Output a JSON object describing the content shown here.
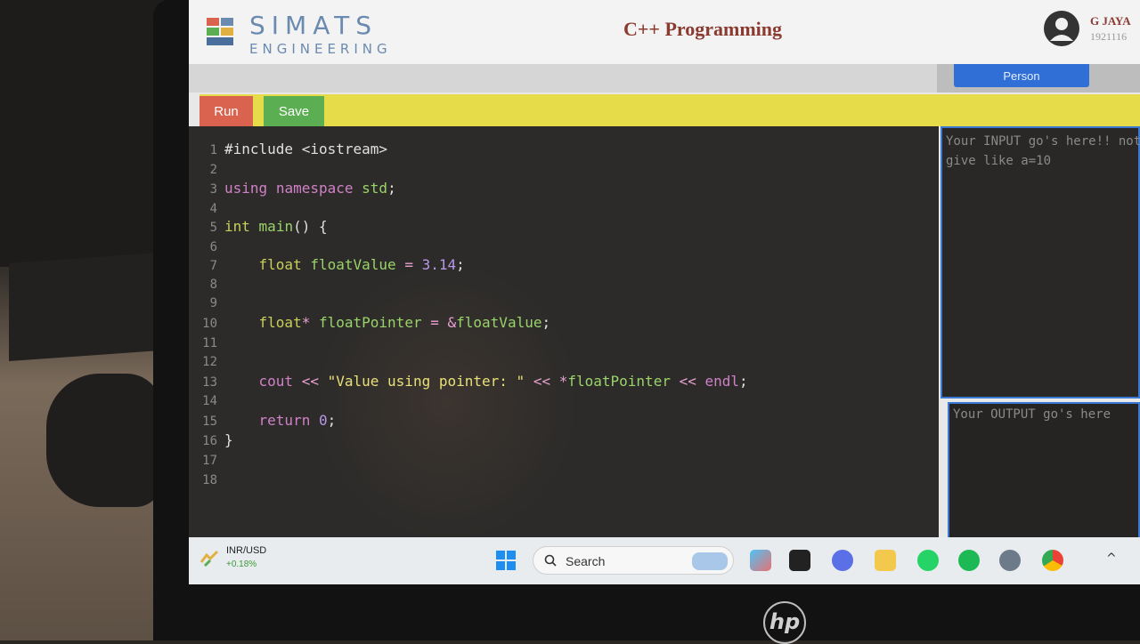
{
  "header": {
    "logo_name": "SIMATS",
    "logo_sub": "ENGINEERING",
    "title": "C++ Programming",
    "user_name": "G JAYA",
    "user_id": "1921116"
  },
  "subbar": {
    "person_label": "Person"
  },
  "toolbar": {
    "run_label": "Run",
    "save_label": "Save"
  },
  "editor": {
    "lines": [
      {
        "n": "1",
        "text": "#include <iostream>"
      },
      {
        "n": "2",
        "text": ""
      },
      {
        "n": "3",
        "text": "using namespace std;"
      },
      {
        "n": "4",
        "text": ""
      },
      {
        "n": "5",
        "text": "int main() {"
      },
      {
        "n": "6",
        "text": ""
      },
      {
        "n": "7",
        "text": "    float floatValue = 3.14;"
      },
      {
        "n": "8",
        "text": ""
      },
      {
        "n": "9",
        "text": ""
      },
      {
        "n": "10",
        "text": "    float* floatPointer = &floatValue;"
      },
      {
        "n": "11",
        "text": ""
      },
      {
        "n": "12",
        "text": ""
      },
      {
        "n": "13",
        "text": "    cout << \"Value using pointer: \" << *floatPointer << endl;"
      },
      {
        "n": "14",
        "text": ""
      },
      {
        "n": "15",
        "text": "    return 0;"
      },
      {
        "n": "16",
        "text": "}"
      },
      {
        "n": "17",
        "text": ""
      },
      {
        "n": "18",
        "text": ""
      }
    ]
  },
  "input_panel": {
    "placeholder": "Your INPUT go's here!! not give like a=10"
  },
  "output_panel": {
    "placeholder": "Your OUTPUT go's here"
  },
  "taskbar": {
    "ticker_symbol": "INR/USD",
    "ticker_change": "+0.18%",
    "search_label": "Search",
    "icons": [
      "widgets-icon",
      "task-view-icon",
      "meet-icon",
      "file-explorer-icon",
      "whatsapp-icon",
      "spotify-icon",
      "settings-icon",
      "chrome-icon"
    ]
  },
  "colors": {
    "accent_blue": "#2f6fd6",
    "run_button": "#d9634e",
    "save_button": "#5cae52",
    "toolbar": "#e6dc4a",
    "title": "#8b3a2f"
  }
}
